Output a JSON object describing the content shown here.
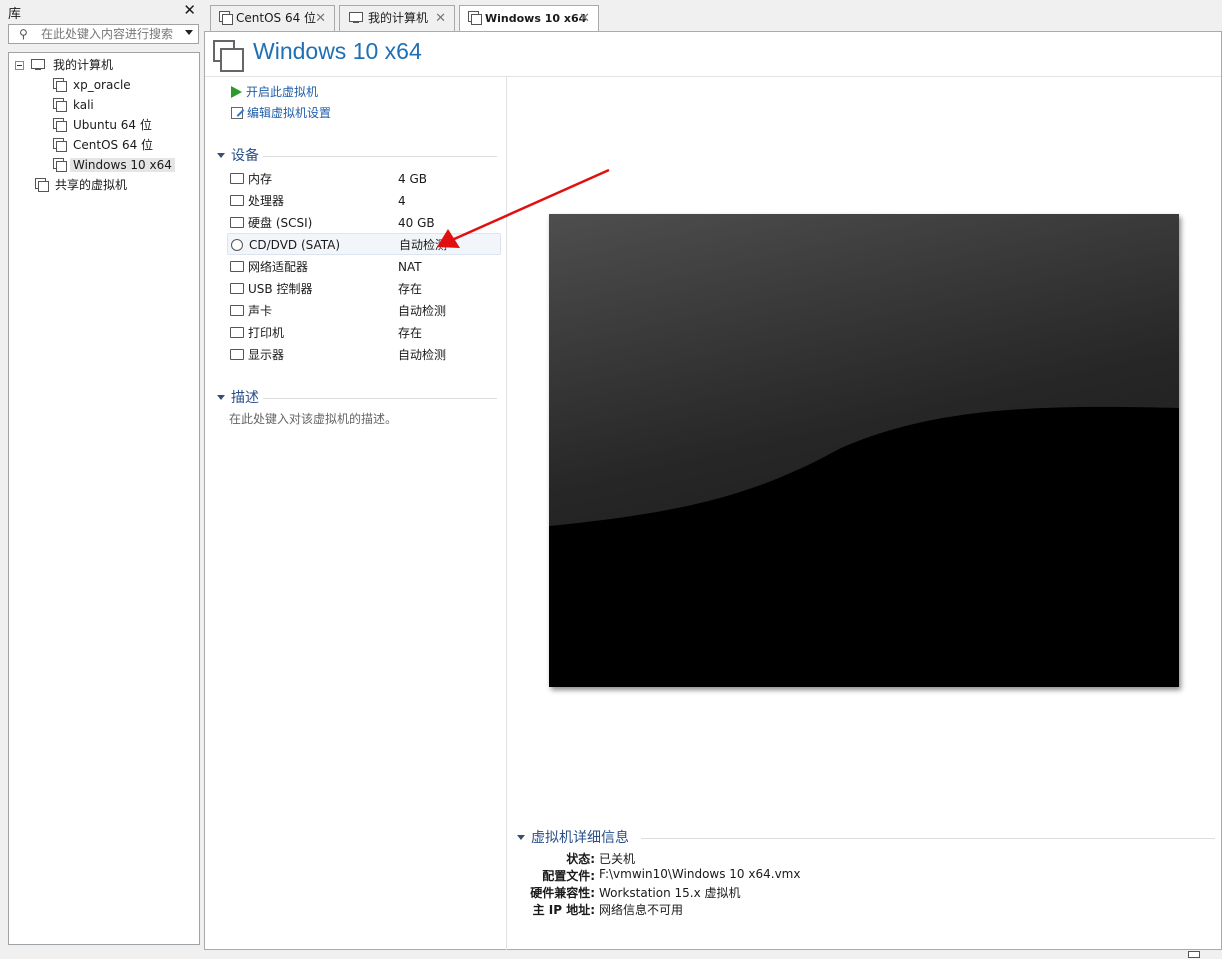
{
  "library": {
    "title": "库",
    "search_placeholder": "在此处键入内容进行搜索",
    "tree": {
      "root_label": "我的计算机",
      "vms": [
        "xp_oracle",
        "kali",
        "Ubuntu 64 位",
        "CentOS 64 位",
        "Windows 10 x64"
      ],
      "selected_vm": "Windows 10 x64",
      "shared_label": "共享的虚拟机"
    }
  },
  "tabs": [
    {
      "label": "CentOS 64 位",
      "active": false
    },
    {
      "label": "我的计算机",
      "active": false
    },
    {
      "label": "Windows 10 x64",
      "active": true
    }
  ],
  "vm": {
    "title": "Windows 10 x64",
    "actions": {
      "power_on": "开启此虚拟机",
      "edit_settings": "编辑虚拟机设置"
    },
    "devices_header": "设备",
    "devices": [
      {
        "name": "内存",
        "value": "4 GB",
        "icon": "memory-icon"
      },
      {
        "name": "处理器",
        "value": "4",
        "icon": "cpu-icon"
      },
      {
        "name": "硬盘 (SCSI)",
        "value": "40 GB",
        "icon": "hard-disk-icon"
      },
      {
        "name": "CD/DVD (SATA)",
        "value": "自动检测",
        "icon": "cd-dvd-icon"
      },
      {
        "name": "网络适配器",
        "value": "NAT",
        "icon": "network-adapter-icon"
      },
      {
        "name": "USB 控制器",
        "value": "存在",
        "icon": "usb-icon"
      },
      {
        "name": "声卡",
        "value": "自动检测",
        "icon": "speaker-icon"
      },
      {
        "name": "打印机",
        "value": "存在",
        "icon": "printer-icon"
      },
      {
        "name": "显示器",
        "value": "自动检测",
        "icon": "monitor-icon"
      }
    ],
    "description_header": "描述",
    "description_placeholder": "在此处键入对该虚拟机的描述。",
    "details": {
      "header": "虚拟机详细信息",
      "status_label": "状态:",
      "status": "已关机",
      "config_label": "配置文件:",
      "config": "F:\\vmwin10\\Windows 10 x64.vmx",
      "compat_label": "硬件兼容性:",
      "compat": "Workstation 15.x 虚拟机",
      "ip_label": "主 IP 地址:",
      "ip": "网络信息不可用"
    }
  },
  "colors": {
    "accent": "#1f6fb5",
    "annotation_arrow": "#e01010"
  }
}
